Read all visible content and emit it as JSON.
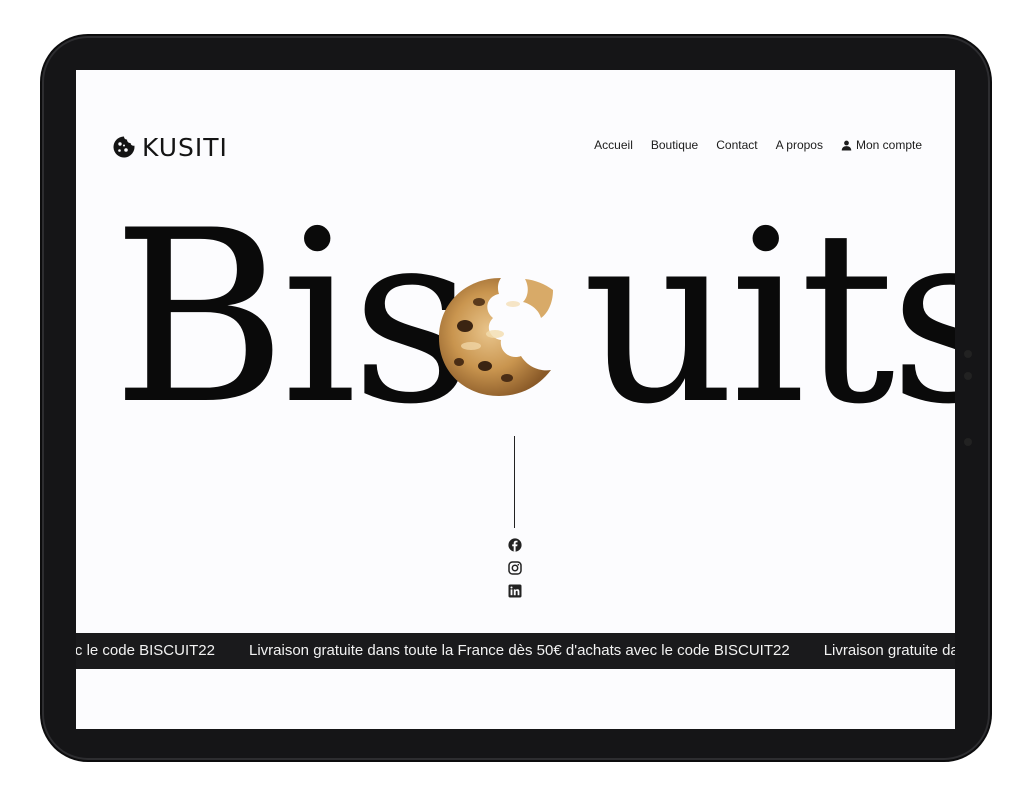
{
  "brand": {
    "name": "KUSITI"
  },
  "nav": {
    "items": [
      {
        "label": "Accueil"
      },
      {
        "label": "Boutique"
      },
      {
        "label": "Contact"
      },
      {
        "label": "A propos"
      },
      {
        "label": "Mon compte",
        "icon": "user-icon"
      }
    ]
  },
  "hero": {
    "part1": "Bis",
    "part2": "uits",
    "cookie_icon": "cookie-image"
  },
  "socials": [
    {
      "icon": "facebook-icon"
    },
    {
      "icon": "instagram-icon"
    },
    {
      "icon": "linkedin-icon"
    }
  ],
  "banner": {
    "text": "Livraison gratuite dans toute la France dès 50€ d'achats avec le code BISCUIT22"
  },
  "colors": {
    "background": "#fcfcfe",
    "ink": "#0a0a0a",
    "banner_bg": "#1a1a1c",
    "banner_text": "#f2f2f2"
  }
}
